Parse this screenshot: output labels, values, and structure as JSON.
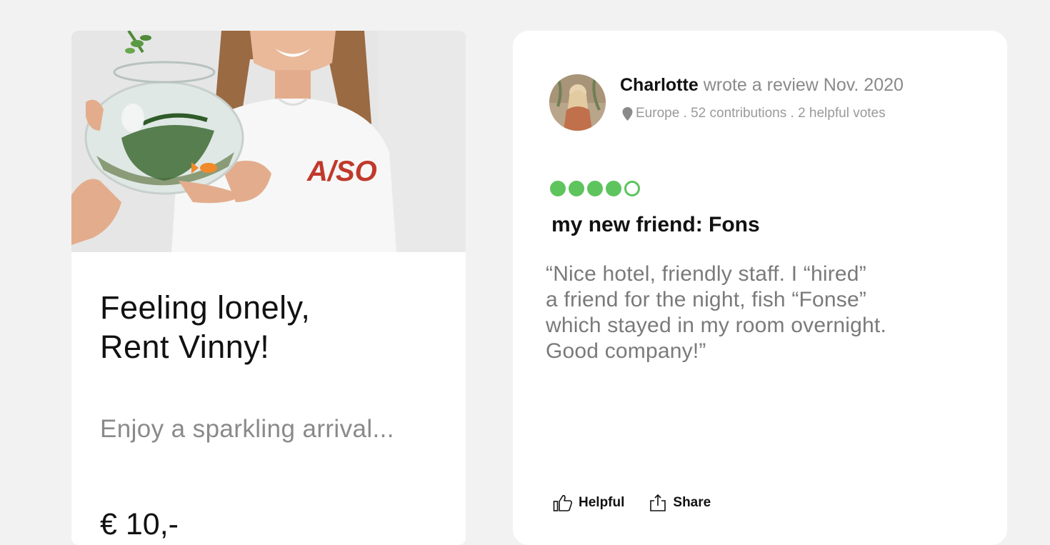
{
  "product": {
    "title_line1": "Feeling lonely,",
    "title_line2": "Rent Vinny!",
    "subtitle": "Enjoy a sparkling arrival...",
    "price": "€ 10,-",
    "photo_shirt_text": "A/SO"
  },
  "review": {
    "reviewer_name": "Charlotte",
    "reviewer_action": "wrote a review Nov. 2020",
    "meta": "Europe . 52 contributions . 2 helpful votes",
    "rating": 4,
    "rating_max": 5,
    "title": "my new friend: Fons",
    "body_lines": [
      "“Nice hotel, friendly staff. I “hired”",
      "a friend for the night, fish “Fonse”",
      "which stayed in my room overnight.",
      "Good company!”"
    ],
    "actions": {
      "helpful_label": "Helpful",
      "share_label": "Share"
    }
  },
  "colors": {
    "rating_green": "#5ec45e",
    "background": "#f2f2f2",
    "muted_text": "#8a8a8a"
  },
  "icons": {
    "location": "pin-icon",
    "helpful": "thumbs-up-icon",
    "share": "share-icon"
  }
}
